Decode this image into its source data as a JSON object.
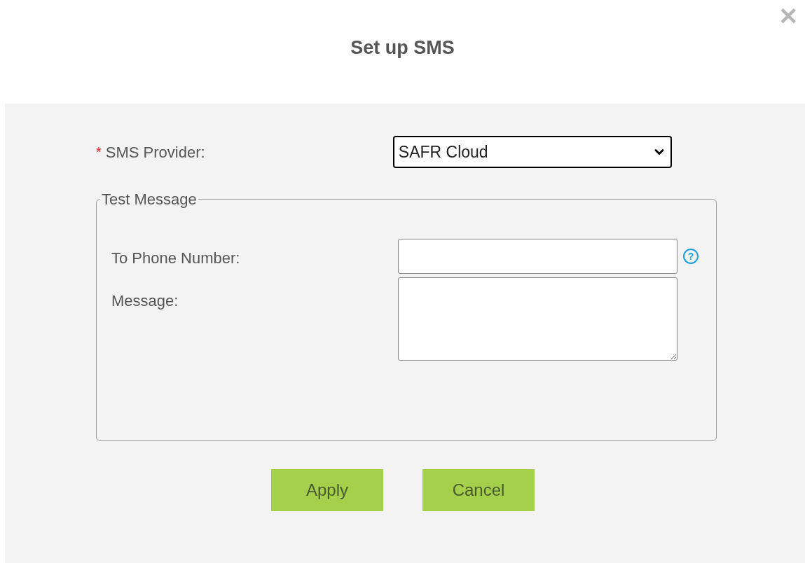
{
  "dialog": {
    "title": "Set up SMS",
    "close": "✕"
  },
  "provider": {
    "required_mark": "*",
    "label": "SMS Provider:",
    "value": "SAFR Cloud"
  },
  "test_message": {
    "legend": "Test Message",
    "fields": [
      {
        "kind": "input",
        "label": "To Phone Number:",
        "help": "?"
      },
      {
        "kind": "textarea",
        "label": "Message:"
      }
    ]
  },
  "buttons": [
    "Apply",
    "Cancel"
  ]
}
